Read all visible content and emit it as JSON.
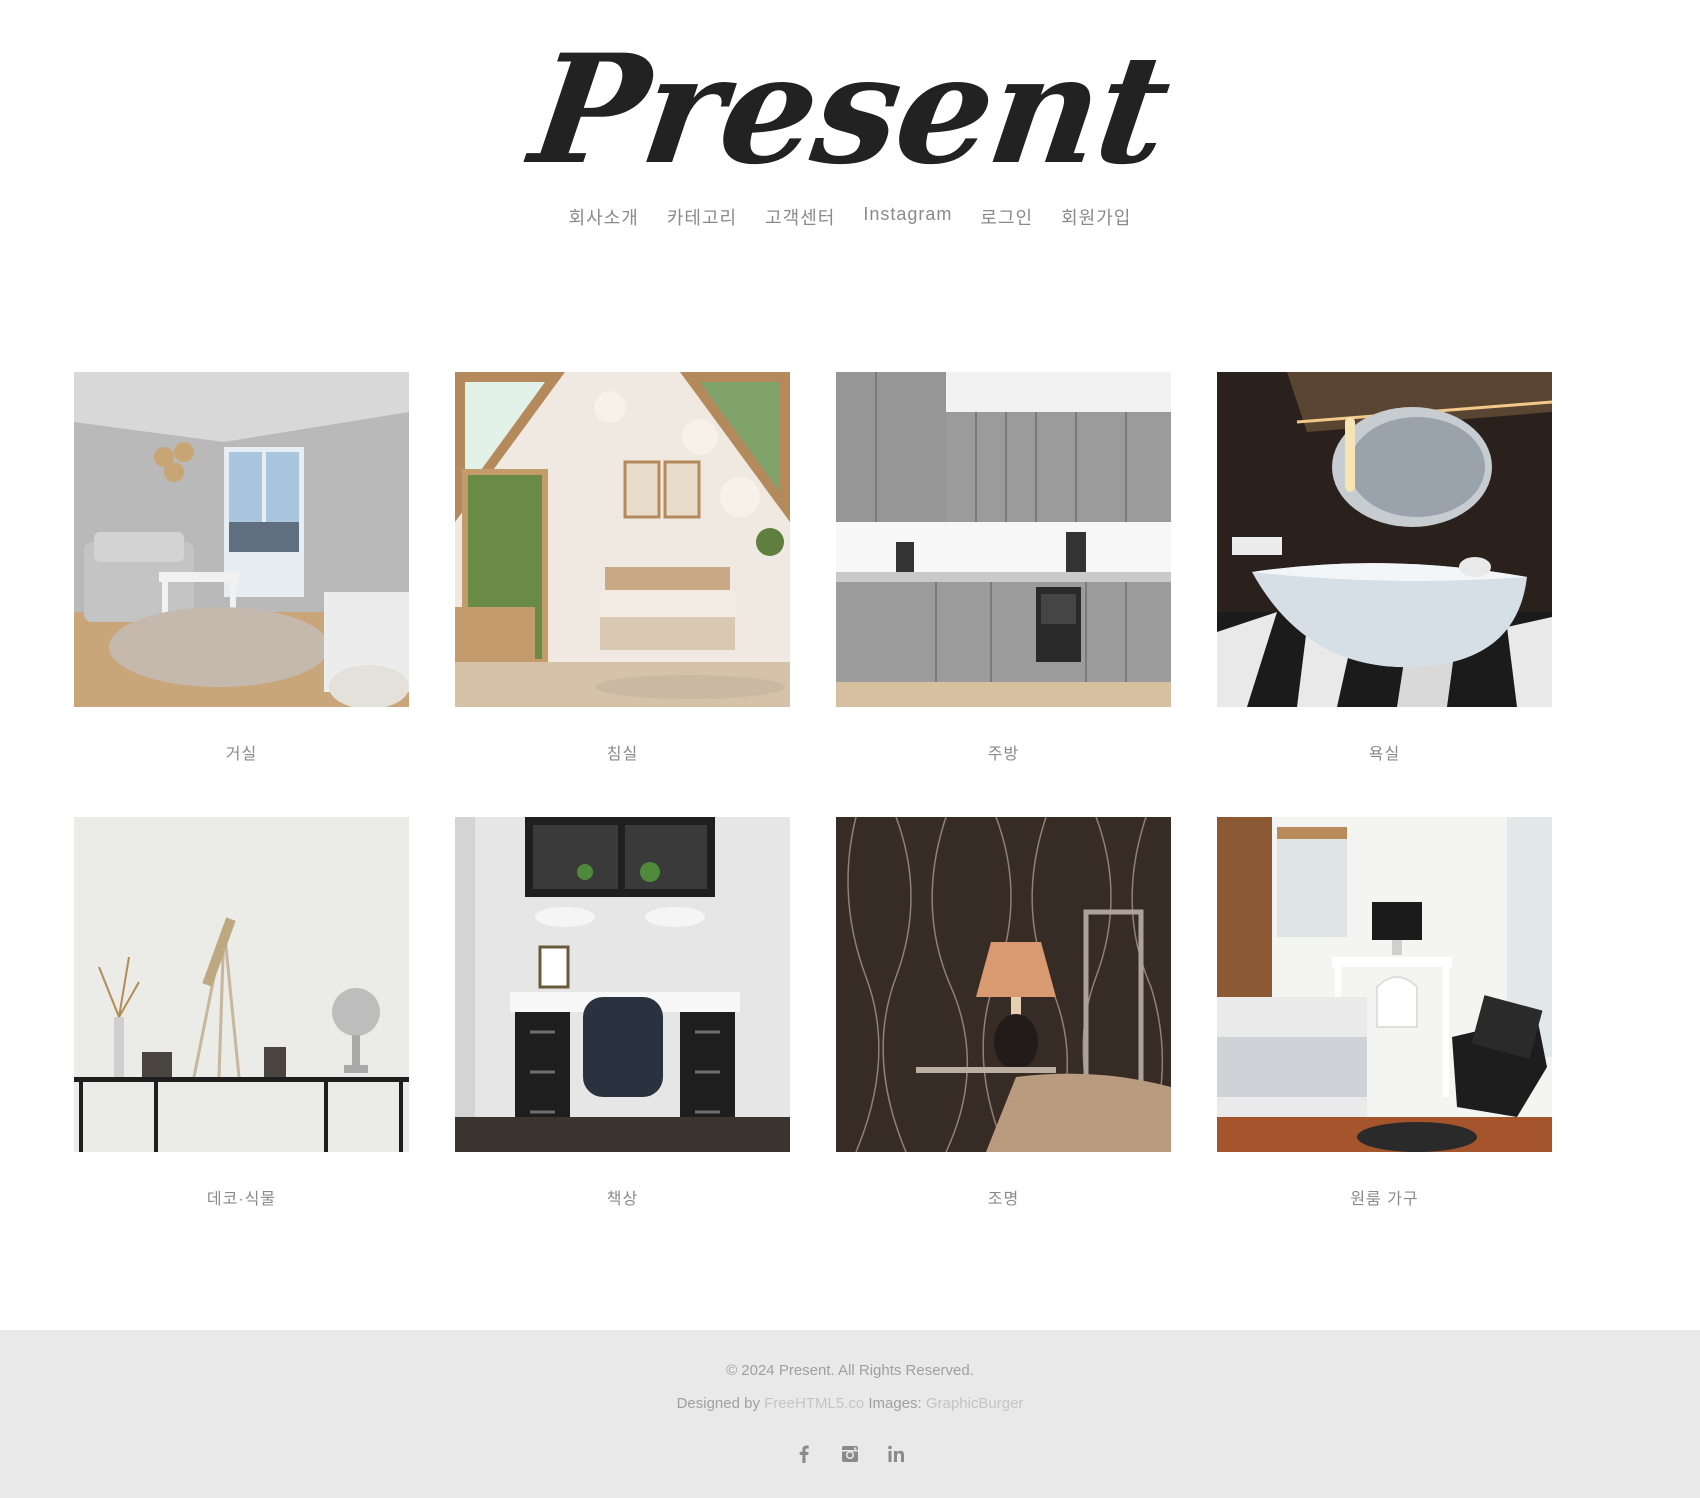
{
  "header": {
    "logo_text": "Present",
    "nav": [
      {
        "label": "회사소개"
      },
      {
        "label": "카테고리"
      },
      {
        "label": "고객센터"
      },
      {
        "label": "Instagram"
      },
      {
        "label": "로그인"
      },
      {
        "label": "회원가입"
      }
    ]
  },
  "gallery": {
    "items": [
      {
        "caption": "거실",
        "image": "living-room-photo"
      },
      {
        "caption": "침실",
        "image": "bedroom-photo"
      },
      {
        "caption": "주방",
        "image": "kitchen-photo"
      },
      {
        "caption": "욕실",
        "image": "bathroom-photo"
      },
      {
        "caption": "데코·식물",
        "image": "decor-plants-photo"
      },
      {
        "caption": "책상",
        "image": "desk-photo"
      },
      {
        "caption": "조명",
        "image": "lighting-photo"
      },
      {
        "caption": "원룸 가구",
        "image": "studio-furniture-photo"
      }
    ]
  },
  "footer": {
    "copyright": "© 2024 Present. All Rights Reserved.",
    "designed_by_label": "Designed by",
    "designed_by_link": "FreeHTML5.co",
    "images_label": "Images:",
    "images_link": "GraphicBurger",
    "social": [
      "facebook-icon",
      "instagram-icon",
      "linkedin-icon"
    ]
  },
  "colors": {
    "text_muted": "#8a8a8a",
    "footer_bg": "#e9e9e9",
    "logo": "#222222"
  }
}
